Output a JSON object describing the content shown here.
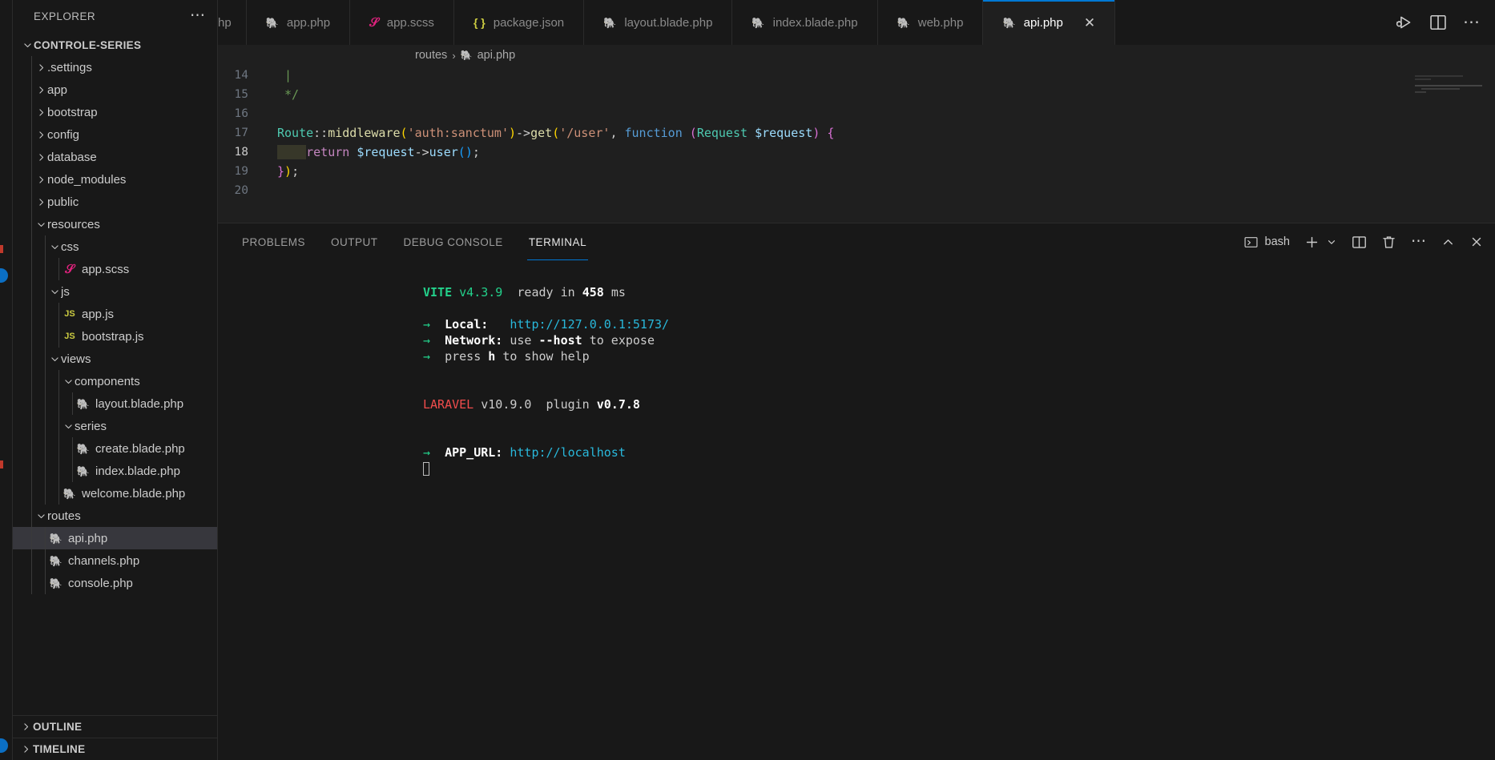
{
  "sidebar": {
    "title": "EXPLORER",
    "more_icon": "ellipsis-icon",
    "root": {
      "label": "CONTROLE-SERIES"
    },
    "items": [
      {
        "label": ".settings",
        "indent": 1,
        "type": "folder",
        "expanded": false
      },
      {
        "label": "app",
        "indent": 1,
        "type": "folder",
        "expanded": false
      },
      {
        "label": "bootstrap",
        "indent": 1,
        "type": "folder",
        "expanded": false
      },
      {
        "label": "config",
        "indent": 1,
        "type": "folder",
        "expanded": false
      },
      {
        "label": "database",
        "indent": 1,
        "type": "folder",
        "expanded": false
      },
      {
        "label": "node_modules",
        "indent": 1,
        "type": "folder",
        "expanded": false
      },
      {
        "label": "public",
        "indent": 1,
        "type": "folder",
        "expanded": false
      },
      {
        "label": "resources",
        "indent": 1,
        "type": "folder",
        "expanded": true
      },
      {
        "label": "css",
        "indent": 2,
        "type": "folder",
        "expanded": true
      },
      {
        "label": "app.scss",
        "indent": 3,
        "type": "scss"
      },
      {
        "label": "js",
        "indent": 2,
        "type": "folder",
        "expanded": true
      },
      {
        "label": "app.js",
        "indent": 3,
        "type": "js"
      },
      {
        "label": "bootstrap.js",
        "indent": 3,
        "type": "js"
      },
      {
        "label": "views",
        "indent": 2,
        "type": "folder",
        "expanded": true
      },
      {
        "label": "components",
        "indent": 3,
        "type": "folder",
        "expanded": true
      },
      {
        "label": "layout.blade.php",
        "indent": 4,
        "type": "php"
      },
      {
        "label": "series",
        "indent": 3,
        "type": "folder",
        "expanded": true
      },
      {
        "label": "create.blade.php",
        "indent": 4,
        "type": "php"
      },
      {
        "label": "index.blade.php",
        "indent": 4,
        "type": "php"
      },
      {
        "label": "welcome.blade.php",
        "indent": 3,
        "type": "php"
      },
      {
        "label": "routes",
        "indent": 1,
        "type": "folder",
        "expanded": true
      },
      {
        "label": "api.php",
        "indent": 2,
        "type": "php",
        "selected": true
      },
      {
        "label": "channels.php",
        "indent": 2,
        "type": "php"
      },
      {
        "label": "console.php",
        "indent": 2,
        "type": "php"
      }
    ],
    "sections": [
      {
        "label": "OUTLINE"
      },
      {
        "label": "TIMELINE"
      }
    ]
  },
  "tabs": [
    {
      "label": "hp",
      "type": "php",
      "active": false,
      "partial": true
    },
    {
      "label": "app.php",
      "type": "php",
      "active": false
    },
    {
      "label": "app.scss",
      "type": "scss",
      "active": false
    },
    {
      "label": "package.json",
      "type": "json",
      "active": false
    },
    {
      "label": "layout.blade.php",
      "type": "php",
      "active": false
    },
    {
      "label": "index.blade.php",
      "type": "php",
      "active": false
    },
    {
      "label": "web.php",
      "type": "php",
      "active": false
    },
    {
      "label": "api.php",
      "type": "php",
      "active": true,
      "close": "✕"
    }
  ],
  "tabbar_actions": [
    {
      "name": "run-and-debug-icon"
    },
    {
      "name": "split-editor-icon"
    },
    {
      "name": "more-actions-icon"
    }
  ],
  "breadcrumb": {
    "folder": "routes",
    "separator": "›",
    "file": "api.php"
  },
  "editor": {
    "lines": [
      {
        "no": "14",
        "segments": [
          {
            "t": " |",
            "c": "c-com"
          }
        ]
      },
      {
        "no": "15",
        "segments": [
          {
            "t": " */",
            "c": "c-com"
          }
        ]
      },
      {
        "no": "16",
        "segments": [
          {
            "t": "",
            "c": "c-punc"
          }
        ]
      },
      {
        "no": "17",
        "segments": [
          {
            "t": "Route",
            "c": "c-cls"
          },
          {
            "t": "::",
            "c": "c-punc"
          },
          {
            "t": "middleware",
            "c": "c-fn"
          },
          {
            "t": "(",
            "c": "c-par1"
          },
          {
            "t": "'auth:sanctum'",
            "c": "c-str"
          },
          {
            "t": ")",
            "c": "c-par1"
          },
          {
            "t": "->",
            "c": "c-punc"
          },
          {
            "t": "get",
            "c": "c-fn"
          },
          {
            "t": "(",
            "c": "c-par1"
          },
          {
            "t": "'/user'",
            "c": "c-str"
          },
          {
            "t": ", ",
            "c": "c-punc"
          },
          {
            "t": "function",
            "c": "c-kw"
          },
          {
            "t": " ",
            "c": "c-punc"
          },
          {
            "t": "(",
            "c": "c-par2"
          },
          {
            "t": "Request",
            "c": "c-cls"
          },
          {
            "t": " ",
            "c": "c-punc"
          },
          {
            "t": "$request",
            "c": "c-var"
          },
          {
            "t": ")",
            "c": "c-par2"
          },
          {
            "t": " ",
            "c": "c-punc"
          },
          {
            "t": "{",
            "c": "c-par2"
          }
        ]
      },
      {
        "no": "18",
        "current": true,
        "segments": [
          {
            "t": "    ",
            "c": "cursor-hl"
          },
          {
            "t": "return",
            "c": "c-ctl"
          },
          {
            "t": " ",
            "c": "c-punc"
          },
          {
            "t": "$request",
            "c": "c-var"
          },
          {
            "t": "->",
            "c": "c-punc"
          },
          {
            "t": "user",
            "c": "c-var"
          },
          {
            "t": "(",
            "c": "c-par3"
          },
          {
            "t": ")",
            "c": "c-par3"
          },
          {
            "t": ";",
            "c": "c-punc"
          }
        ]
      },
      {
        "no": "19",
        "segments": [
          {
            "t": "}",
            "c": "c-par2"
          },
          {
            "t": ")",
            "c": "c-par1"
          },
          {
            "t": ";",
            "c": "c-punc"
          }
        ]
      },
      {
        "no": "20",
        "segments": [
          {
            "t": "",
            "c": "c-punc"
          }
        ]
      }
    ]
  },
  "panel": {
    "tabs": [
      {
        "label": "PROBLEMS",
        "active": false
      },
      {
        "label": "OUTPUT",
        "active": false
      },
      {
        "label": "DEBUG CONSOLE",
        "active": false
      },
      {
        "label": "TERMINAL",
        "active": true
      }
    ],
    "shell": {
      "icon": "terminal-chevron-icon",
      "label": "bash"
    },
    "actions": [
      {
        "name": "new-terminal-icon",
        "glyph": "+"
      },
      {
        "name": "chevron-down-icon",
        "glyph": "⌄"
      },
      {
        "name": "split-terminal-icon"
      },
      {
        "name": "kill-terminal-icon"
      },
      {
        "name": "terminal-more-icon",
        "glyph": "…"
      },
      {
        "name": "maximize-panel-icon",
        "glyph": "⌃"
      },
      {
        "name": "close-panel-icon",
        "glyph": "✕"
      }
    ],
    "terminal": {
      "vite": {
        "name": "VITE",
        "version": "v4.3.9",
        "ready": "ready in",
        "ms": "458",
        "unit": "ms"
      },
      "arrow": "→",
      "local": {
        "label": "Local:",
        "url": "http://127.0.0.1:5173/"
      },
      "network": {
        "label": "Network:",
        "pre": "use ",
        "flag": "--host",
        "post": " to expose"
      },
      "help": {
        "pre": "press ",
        "key": "h",
        "post": " to show help"
      },
      "laravel": {
        "name": "LARAVEL",
        "version": "v10.9.0",
        "plugin_label": "plugin",
        "plugin_version": "v0.7.8"
      },
      "app_url": {
        "label": "APP_URL:",
        "url": "http://localhost"
      }
    }
  },
  "colors": {
    "accent": "#0078d4",
    "bg": "#1f1f1f",
    "sidebar_bg": "#181818",
    "selection": "#37373d",
    "php_purple": "#a47ddb",
    "scss_pink": "#e3227f",
    "js_yellow": "#cbcb41",
    "term_green": "#23d18b",
    "term_cyan": "#29b8db",
    "term_red": "#f14c4c"
  }
}
